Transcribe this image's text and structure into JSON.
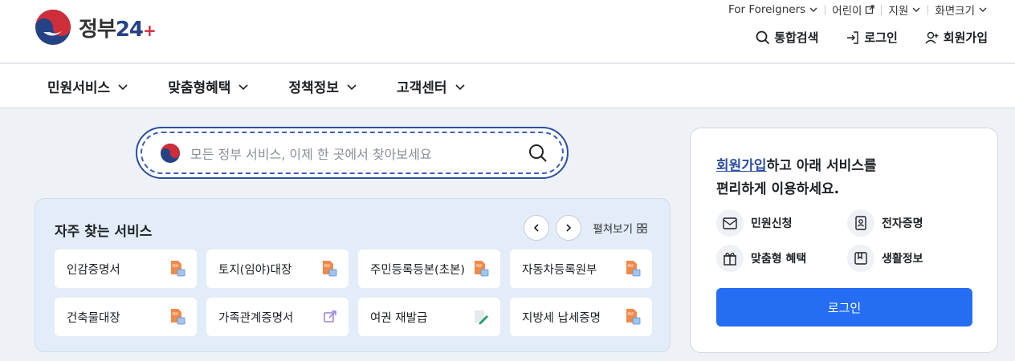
{
  "header": {
    "logo": {
      "text_main": "정부",
      "text_num": "24",
      "text_plus": "+"
    },
    "util": [
      {
        "label": "For Foreigners",
        "icon": "chevron-down-icon"
      },
      {
        "label": "어린이",
        "icon": "external-link-icon"
      },
      {
        "label": "지원",
        "icon": "chevron-down-icon"
      },
      {
        "label": "화면크기",
        "icon": "chevron-down-icon"
      }
    ],
    "actions": {
      "search": "통합검색",
      "login": "로그인",
      "signup": "회원가입"
    }
  },
  "nav": {
    "items": [
      "민원서비스",
      "맞춤형혜택",
      "정책정보",
      "고객센터"
    ]
  },
  "search": {
    "placeholder": "모든 정부 서비스, 이제 한 곳에서 찾아보세요"
  },
  "frequent": {
    "title": "자주 찾는 서비스",
    "expand_label": "펼쳐보기",
    "items": [
      {
        "label": "인감증명서",
        "icon": "document-pdf-icon"
      },
      {
        "label": "토지(임야)대장",
        "icon": "document-pdf-icon"
      },
      {
        "label": "주민등록등본(초본)",
        "icon": "document-pdf-icon"
      },
      {
        "label": "자동차등록원부",
        "icon": "document-pdf-icon"
      },
      {
        "label": "건축물대장",
        "icon": "document-pdf-icon"
      },
      {
        "label": "가족관계증명서",
        "icon": "external-link-icon"
      },
      {
        "label": "여권 재발급",
        "icon": "edit-document-icon"
      },
      {
        "label": "지방세 납세증명",
        "icon": "document-pdf-icon"
      }
    ]
  },
  "login_panel": {
    "message_link": "회원가입",
    "message_rest1": "하고 아래 서비스를",
    "message_line2": "편리하게 이용하세요.",
    "services": [
      {
        "label": "민원신청",
        "icon": "inbox-icon"
      },
      {
        "label": "전자증명",
        "icon": "id-card-icon"
      },
      {
        "label": "맞춤형 혜택",
        "icon": "gift-icon"
      },
      {
        "label": "생활정보",
        "icon": "bookmark-icon"
      }
    ],
    "login_button": "로그인"
  },
  "colors": {
    "primary": "#256ef4",
    "navy": "#2a4ea0",
    "logo_red": "#cd2e3a",
    "logo_blue": "#254285",
    "freq_bg": "#e2edf9"
  }
}
